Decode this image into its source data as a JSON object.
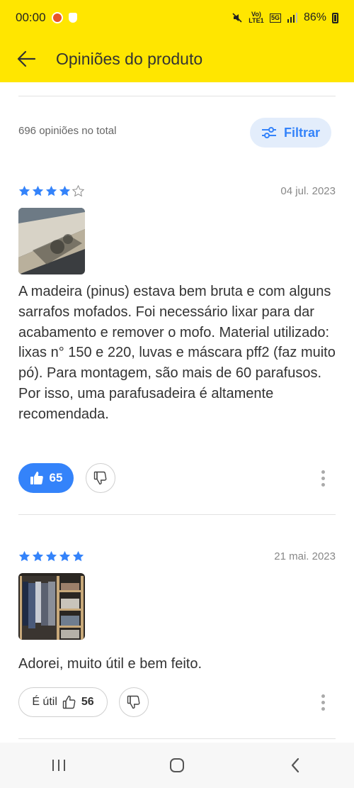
{
  "status_bar": {
    "time": "00:00",
    "battery": "86%",
    "network": "Vo) LTE1",
    "network_gen": "5G"
  },
  "header": {
    "title": "Opiniões do produto",
    "back_icon": "arrow-left-icon",
    "background": "#ffe600"
  },
  "summary": {
    "total_text": "696 opiniões no total",
    "filter_label": "Filtrar"
  },
  "reviews": [
    {
      "rating": 4,
      "max_rating": 5,
      "date": "04 jul. 2023",
      "text": "A madeira (pinus) estava bem bruta e com alguns sarrafos mofados. Foi necessário lixar para dar acabamento e remover o mofo. Material utilizado: lixas n° 150 e 220, luvas e máscara pff2 (faz muito pó). Para montagem, são mais de 60 parafusos. Por isso, uma parafusadeira é altamente recomendada.",
      "likes": "65",
      "liked": true
    },
    {
      "rating": 5,
      "max_rating": 5,
      "date": "21 mai. 2023",
      "text": "Adorei, muito útil e bem feito.",
      "useful_label": "É útil",
      "likes": "56",
      "liked": false
    }
  ],
  "colors": {
    "accent": "#3483fa",
    "accent_light": "#e3edfb",
    "star": "#3483fa"
  }
}
